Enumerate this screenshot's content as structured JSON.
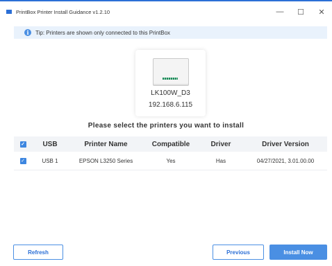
{
  "window": {
    "title": "PrintBox Printer Install Guidance v1.2.10",
    "controls": {
      "minimize": "—",
      "maximize": "☐",
      "close": "✕"
    }
  },
  "tip": {
    "text": "Tip:  Printers are shown only connected to this PrintBox"
  },
  "device": {
    "name": "LK100W_D3",
    "ip": "192.168.6.115"
  },
  "headline": "Please select the printers you want to install",
  "table": {
    "headers": {
      "usb": "USB",
      "name": "Printer Name",
      "compatible": "Compatible",
      "driver": "Driver",
      "version": "Driver Version"
    },
    "rows": [
      {
        "checked": true,
        "usb": "USB 1",
        "name": "EPSON L3250 Series",
        "compatible": "Yes",
        "driver": "Has",
        "version": "04/27/2021, 3.01.00.00"
      }
    ]
  },
  "buttons": {
    "refresh": "Refresh",
    "previous": "Previous",
    "install": "Install Now"
  },
  "colors": {
    "accent": "#2b6fd6",
    "primary_button": "#4a8fe3",
    "tip_bg": "#e9f2fc",
    "header_bg": "#f2f4f7"
  }
}
